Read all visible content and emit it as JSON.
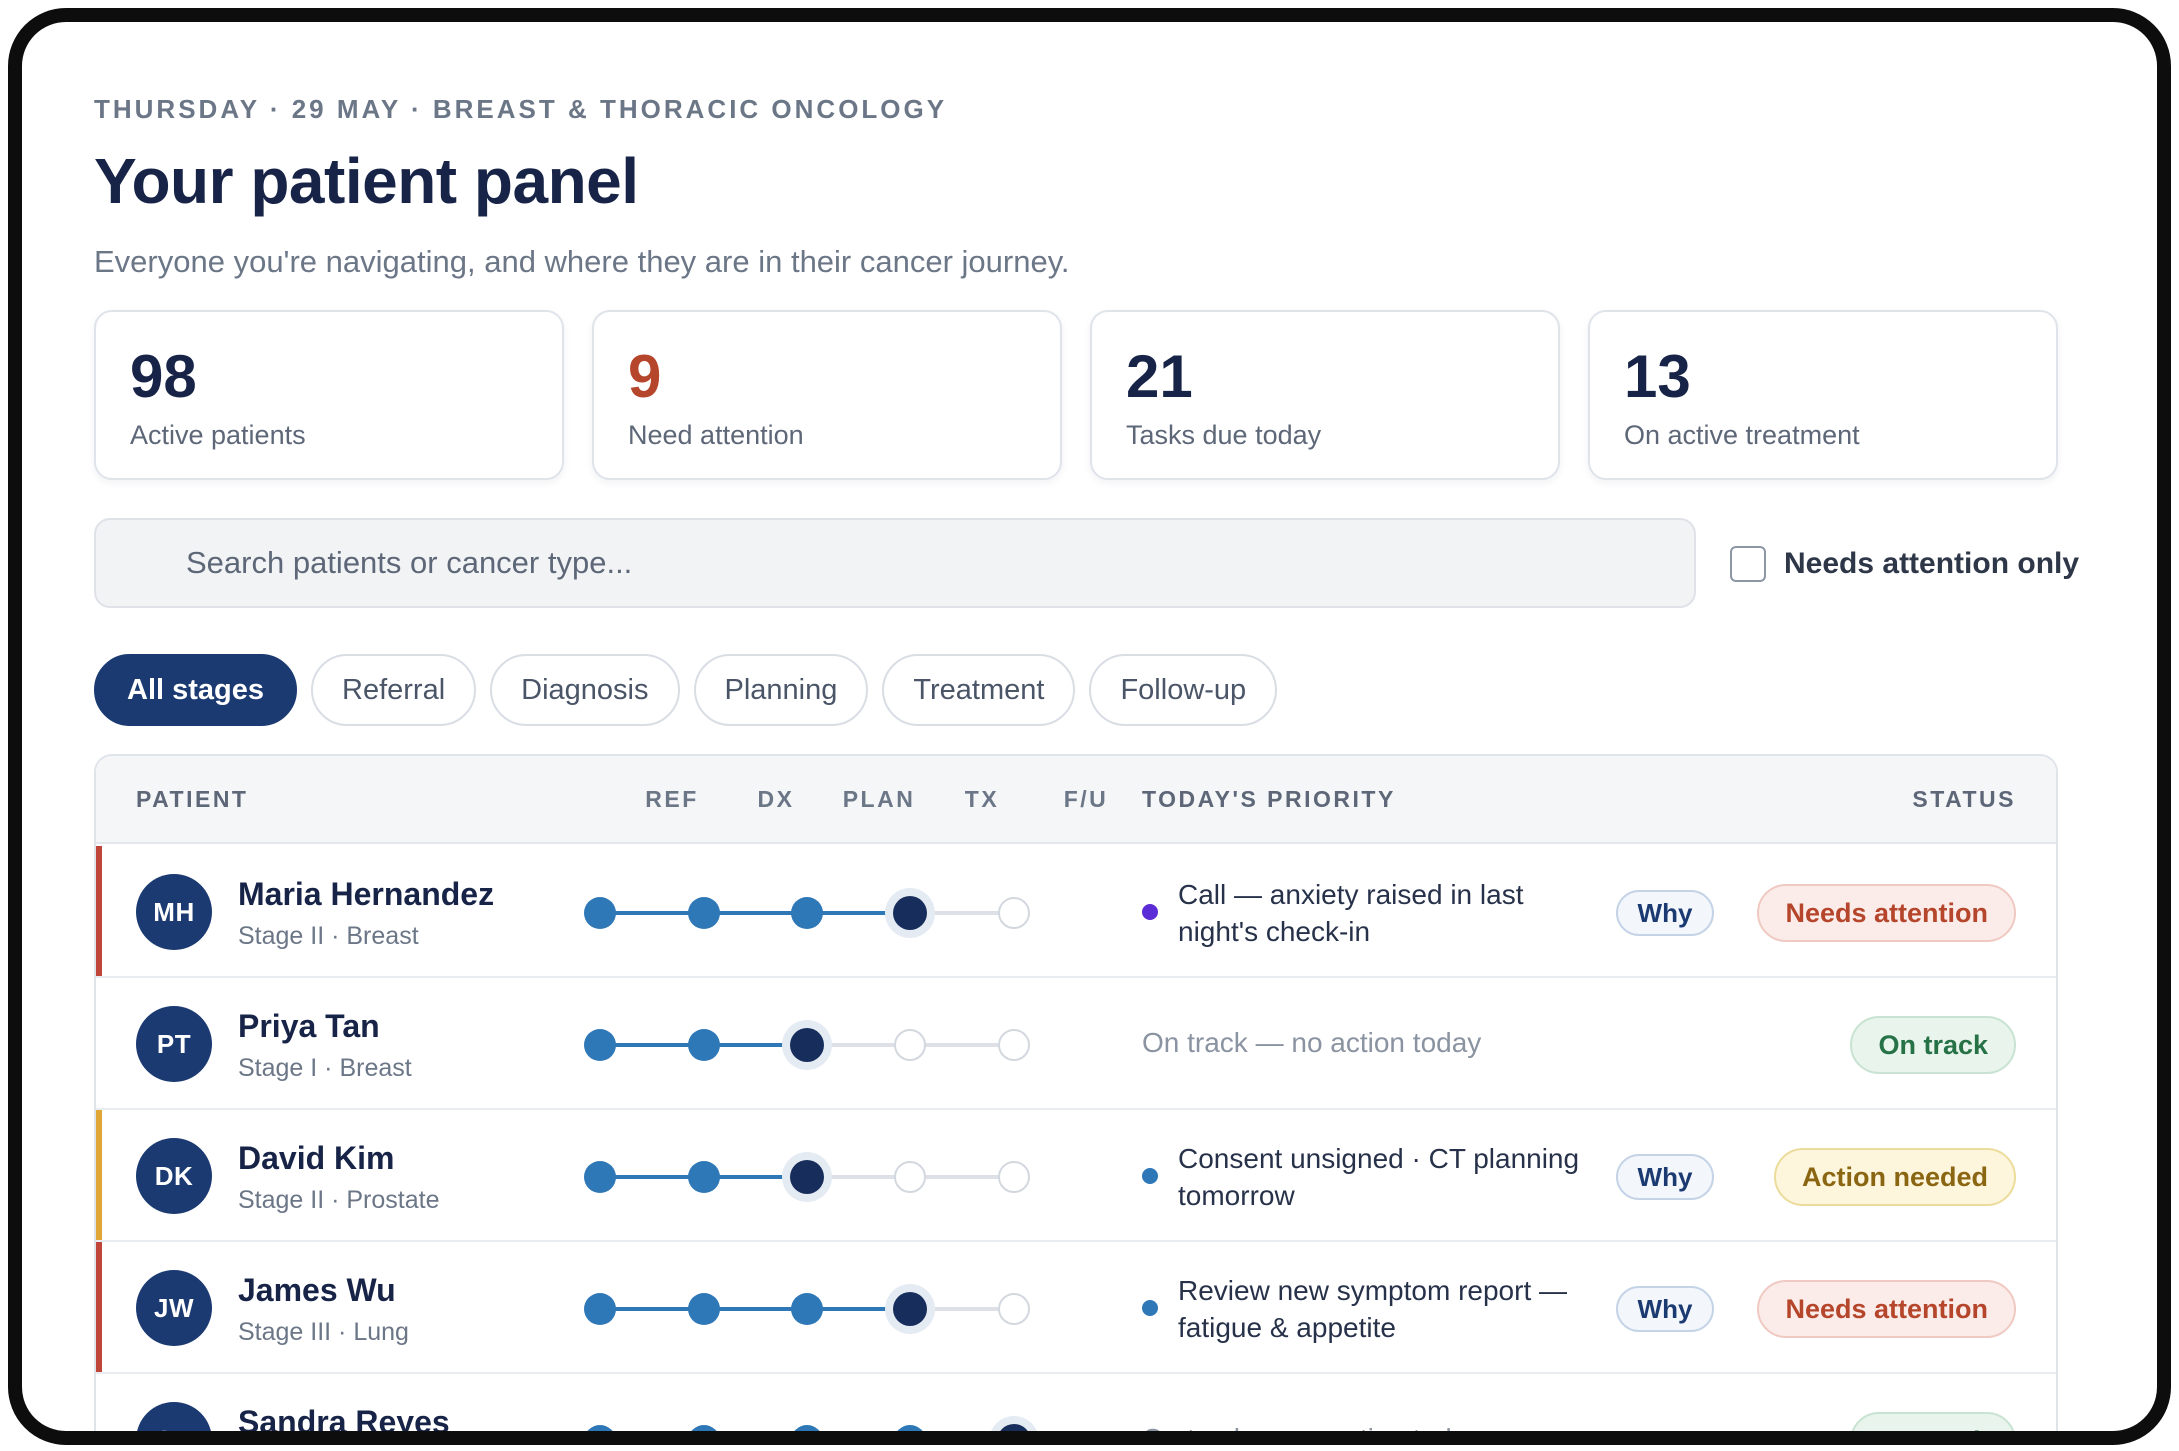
{
  "header": {
    "eyebrow": "THURSDAY · 29 MAY · BREAST & THORACIC ONCOLOGY",
    "title": "Your patient panel",
    "subtitle": "Everyone you're navigating, and where they are in their cancer journey."
  },
  "stats": [
    {
      "value": "98",
      "label": "Active patients"
    },
    {
      "value": "9",
      "label": "Need attention",
      "accent": "#b5462b"
    },
    {
      "value": "21",
      "label": "Tasks due today"
    },
    {
      "value": "13",
      "label": "On active treatment"
    }
  ],
  "search": {
    "placeholder": "Search patients or cancer type...",
    "icon": "search-icon"
  },
  "filter": {
    "label": "Needs attention only",
    "checked": false
  },
  "chips": [
    "All stages",
    "Referral",
    "Diagnosis",
    "Planning",
    "Treatment",
    "Follow-up"
  ],
  "table": {
    "headers": {
      "patient": "PATIENT",
      "ref": "REF",
      "dx": "DX",
      "plan": "PLAN",
      "tx": "TX",
      "fu": "F/U",
      "priority": "TODAY'S PRIORITY",
      "status": "STATUS"
    },
    "why_label": "Why",
    "rows": [
      {
        "initials": "MH",
        "name": "Maria Hernandez",
        "meta": "Stage II · Breast",
        "stage": 4,
        "flag": "#c0463a",
        "priority": "Call — anxiety raised in last night's check-in",
        "bullet": "#5b2bd6",
        "status": "Needs attention",
        "status_type": "attention"
      },
      {
        "initials": "PT",
        "name": "Priya Tan",
        "meta": "Stage I · Breast",
        "stage": 3,
        "flag": null,
        "priority": "On track — no action today",
        "bullet": null,
        "status": "On track",
        "status_type": "ontrack"
      },
      {
        "initials": "DK",
        "name": "David Kim",
        "meta": "Stage II · Prostate",
        "stage": 3,
        "flag": "#e0a636",
        "priority": "Consent unsigned · CT planning tomorrow",
        "bullet": "#2f78b7",
        "status": "Action needed",
        "status_type": "action"
      },
      {
        "initials": "JW",
        "name": "James Wu",
        "meta": "Stage III · Lung",
        "stage": 4,
        "flag": "#c0463a",
        "priority": "Review new symptom report — fatigue & appetite",
        "bullet": "#2f78b7",
        "status": "Needs attention",
        "status_type": "attention"
      },
      {
        "initials": "SR",
        "name": "Sandra Reyes",
        "meta": "",
        "stage": 5,
        "flag": null,
        "priority": "On track — no action today",
        "bullet": null,
        "status": "On track",
        "status_type": "ontrack"
      }
    ]
  }
}
